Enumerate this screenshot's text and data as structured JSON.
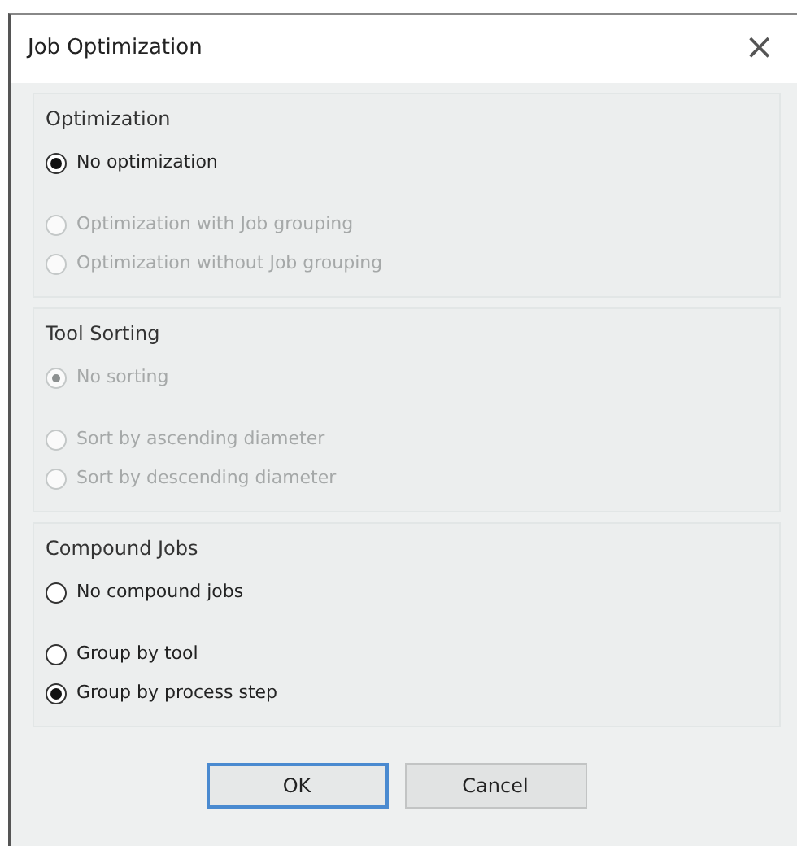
{
  "window": {
    "title": "Job Optimization",
    "close": "×"
  },
  "groups": [
    {
      "title": "Optimization",
      "options": [
        {
          "label": "No optimization",
          "selected": true,
          "disabled": false
        },
        {
          "label": "Optimization with Job grouping",
          "selected": false,
          "disabled": true
        },
        {
          "label": "Optimization without Job grouping",
          "selected": false,
          "disabled": true
        }
      ]
    },
    {
      "title": "Tool Sorting",
      "options": [
        {
          "label": "No sorting",
          "selected": true,
          "disabled": true
        },
        {
          "label": "Sort by ascending diameter",
          "selected": false,
          "disabled": true
        },
        {
          "label": "Sort by descending diameter",
          "selected": false,
          "disabled": true
        }
      ]
    },
    {
      "title": "Compound Jobs",
      "options": [
        {
          "label": "No compound jobs",
          "selected": false,
          "disabled": false
        },
        {
          "label": "Group by tool",
          "selected": false,
          "disabled": false
        },
        {
          "label": "Group by process step",
          "selected": true,
          "disabled": false
        }
      ]
    }
  ],
  "buttons": [
    {
      "label": "OK",
      "default": true
    },
    {
      "label": "Cancel",
      "default": false
    }
  ]
}
